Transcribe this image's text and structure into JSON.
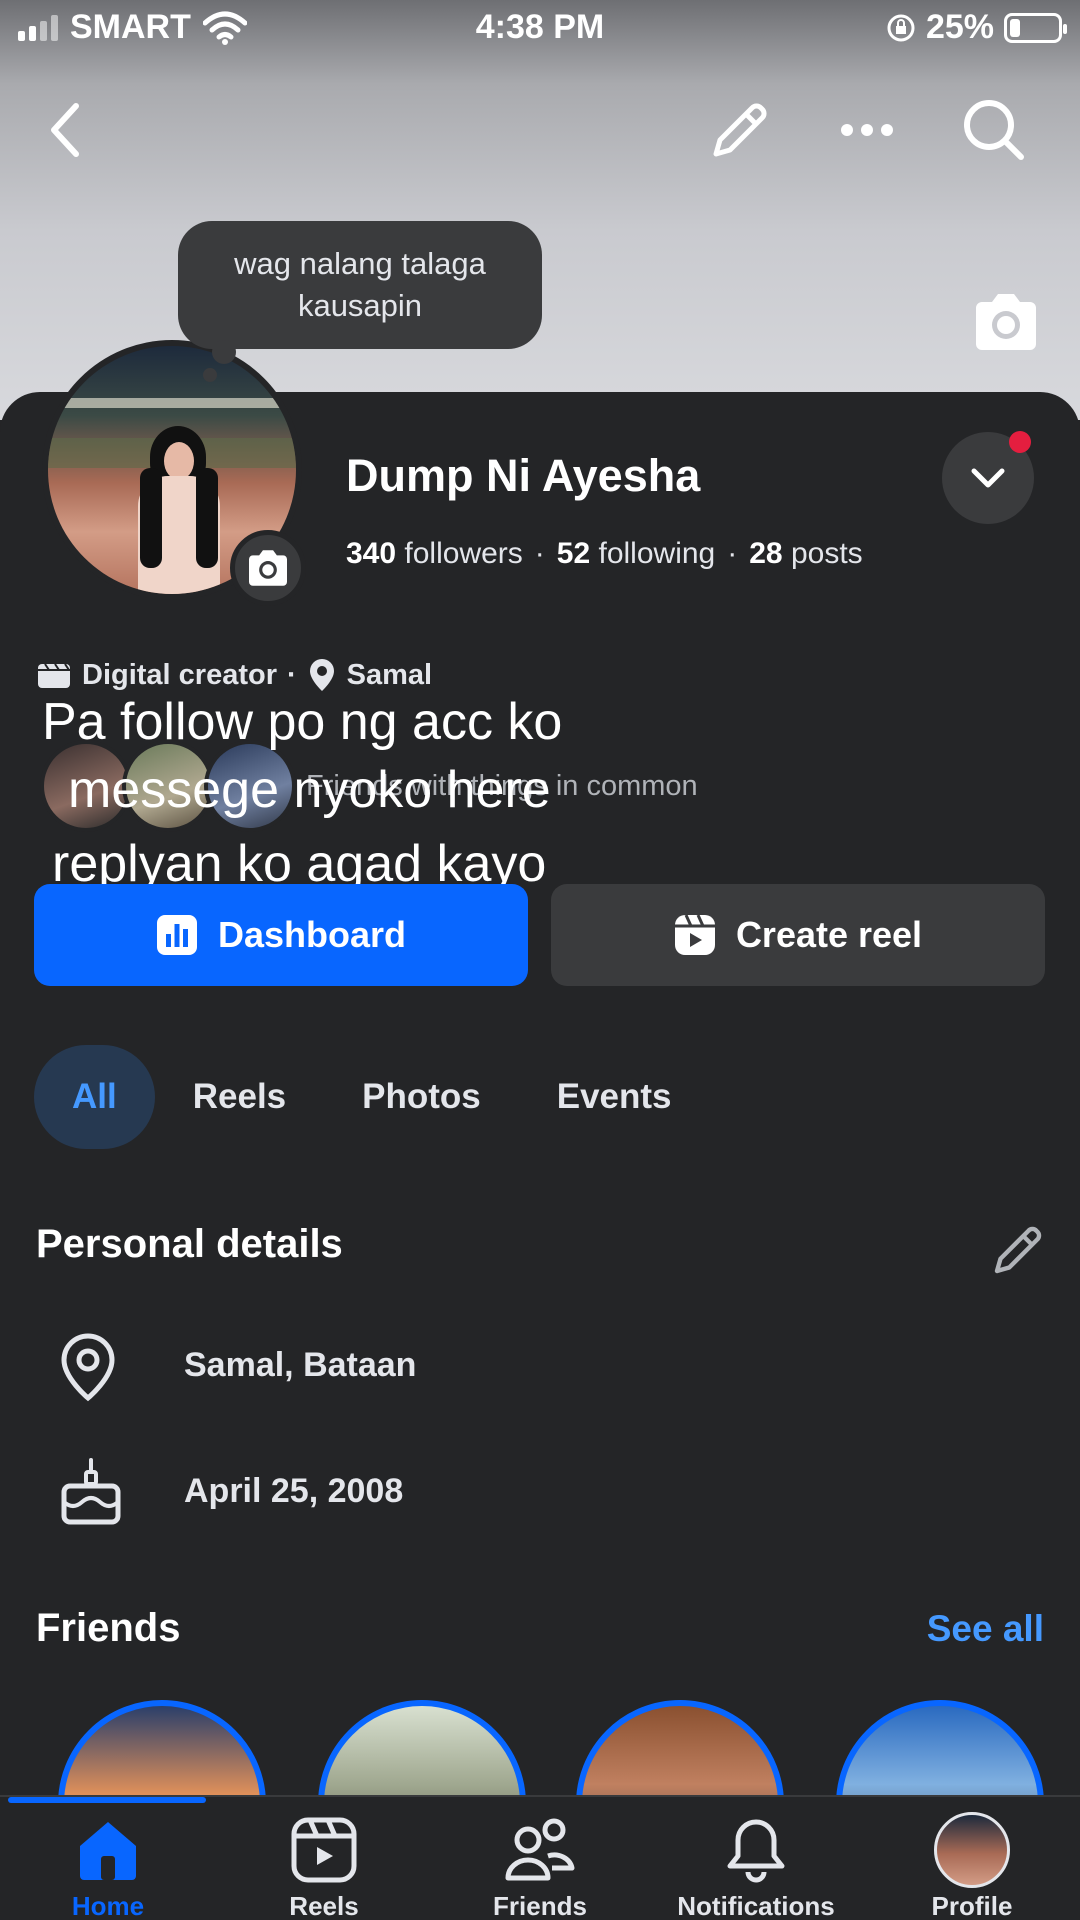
{
  "status_bar": {
    "carrier": "SMART",
    "time": "4:38 PM",
    "battery": "25%"
  },
  "note": {
    "line1": "wag nalang talaga",
    "line2": "kausapin"
  },
  "profile": {
    "name": "Dump Ni Ayesha",
    "followers_count": "340",
    "followers_label": "followers",
    "following_count": "52",
    "following_label": "following",
    "posts_count": "28",
    "posts_label": "posts",
    "category": "Digital creator",
    "location": "Samal",
    "friends_common": "Friends with things in common"
  },
  "overlay_text": {
    "line1": "Pa follow po ng acc ko",
    "line2": "messege nyoko here",
    "line3": "replyan ko agad kayo"
  },
  "buttons": {
    "dashboard": "Dashboard",
    "create_reel": "Create reel"
  },
  "tabs": [
    "All",
    "Reels",
    "Photos",
    "Events"
  ],
  "personal_details": {
    "title": "Personal details",
    "hometown": "Samal, Bataan",
    "birthday": "April 25, 2008"
  },
  "friends_section": {
    "title": "Friends",
    "see_all": "See all"
  },
  "bottom_nav": {
    "home": "Home",
    "reels": "Reels",
    "friends": "Friends",
    "notifications": "Notifications",
    "profile": "Profile"
  },
  "colors": {
    "accent": "#0866ff",
    "link": "#4599ff",
    "background": "#242527",
    "surface": "#3a3b3d",
    "notification_dot": "#e41e3f"
  }
}
